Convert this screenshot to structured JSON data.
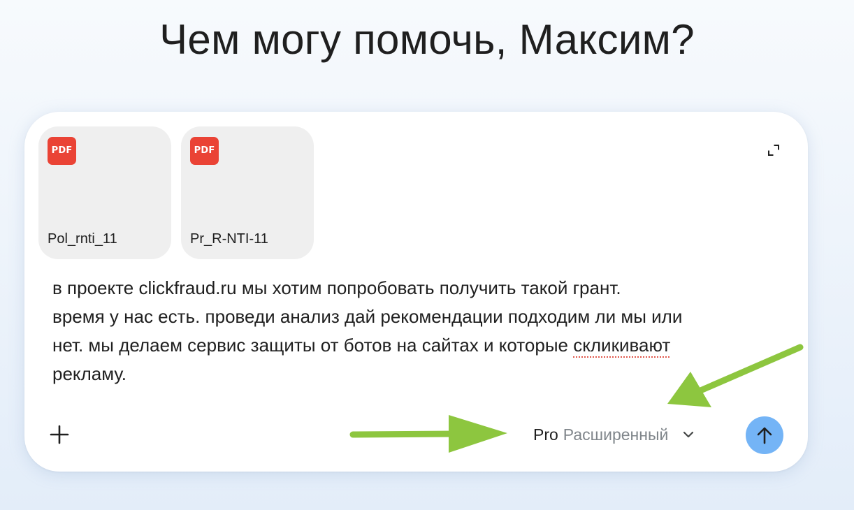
{
  "header": {
    "greeting": "Чем могу помочь, Максим?"
  },
  "attachments": [
    {
      "type_badge": "PDF",
      "name": "Pol_rnti_11",
      "icon": "pdf-icon"
    },
    {
      "type_badge": "PDF",
      "name": "Pr_R-NTI-11",
      "icon": "pdf-icon"
    }
  ],
  "prompt": {
    "text_before_misspelled": "в проекте clickfraud.ru мы хотим попробовать получить такой грант.\nвремя у нас есть. проведи анализ дай рекомендации подходим ли мы или\nнет. мы делаем сервис защиты от ботов на сайтах и которые ",
    "misspelled_word": "скликивают",
    "text_after_misspelled": "\nрекламу."
  },
  "toolbar": {
    "add_icon": "plus-icon",
    "expand_icon": "expand-icon",
    "model_name": "Pro",
    "model_mode": "Расширенный",
    "model_chevron_icon": "chevron-down-icon",
    "send_icon": "arrow-up-icon"
  },
  "colors": {
    "background_top": "#f7fafd",
    "background_bottom": "#e3edf9",
    "card": "#ffffff",
    "attachment_bg": "#efefef",
    "pdf_badge": "#ea4335",
    "send_button": "#74b4f6",
    "annotation_arrow": "#8dc63f",
    "muted_text": "#80868b",
    "spellcheck_underline": "#e0574b"
  },
  "annotations": [
    {
      "type": "arrow",
      "icon": "green-arrow-icon",
      "points_to": "model-select"
    },
    {
      "type": "arrow",
      "icon": "green-arrow-icon",
      "points_to": "model-select"
    }
  ]
}
